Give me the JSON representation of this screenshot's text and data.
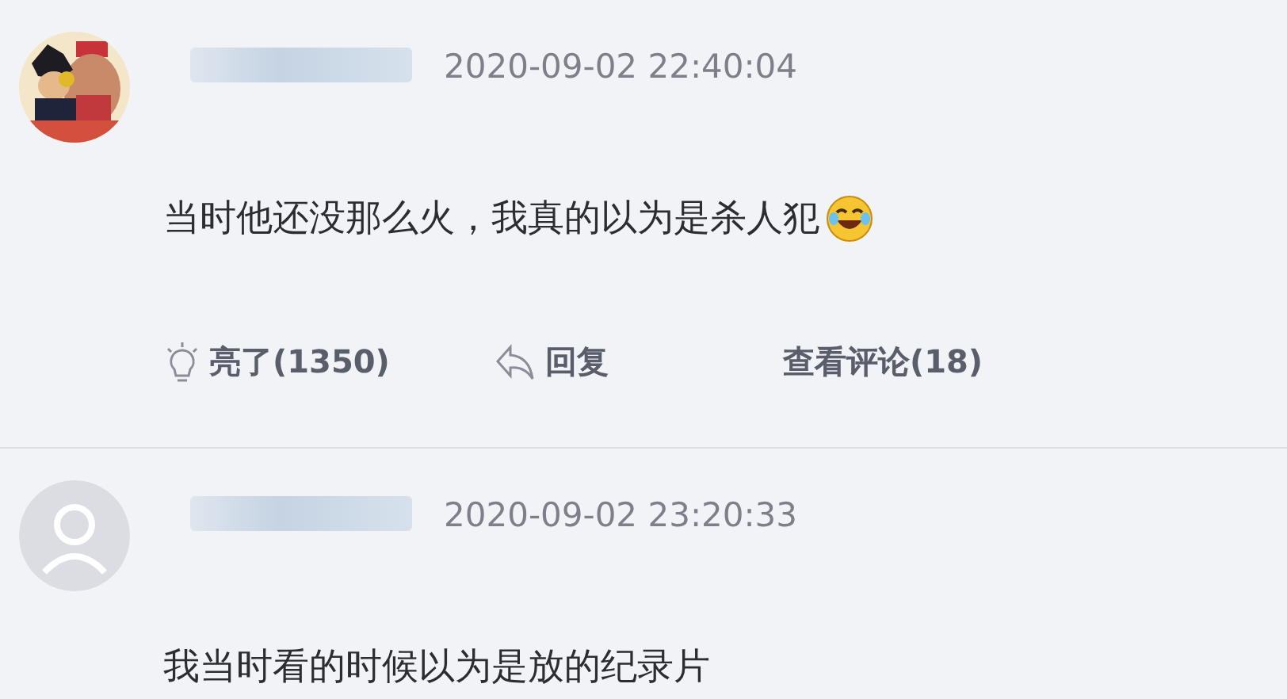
{
  "comments": [
    {
      "date": "2020-09-02 22:40:04",
      "text": "当时他还没那么火，我真的以为是杀人犯",
      "has_emoji": true,
      "actions": [
        {
          "kind": "like",
          "label": "亮了(1350)"
        },
        {
          "kind": "reply",
          "label": "回复"
        },
        {
          "kind": "view",
          "label": "查看评论(18)"
        }
      ]
    },
    {
      "avatar": {
        "kind": "default"
      },
      "has_emoji": false,
      "date": "2020-09-02 23:20:33",
      "text": "我当时看的时候以为是放的纪录片"
    }
  ]
}
